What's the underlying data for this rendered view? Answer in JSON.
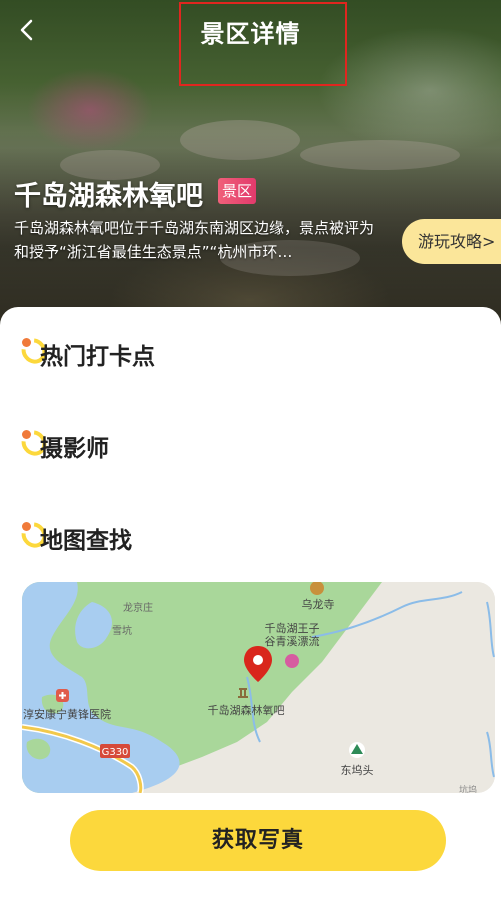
{
  "header": {
    "title": "景区详情"
  },
  "scenic": {
    "name": "千岛湖森林氧吧",
    "badge": "景区",
    "description": "千岛湖森林氧吧位于千岛湖东南湖区边缘，景点被评为和授予“浙江省最佳生态景点”“杭州市环…",
    "guide_button": "游玩攻略>"
  },
  "sections": {
    "hot_spots": "热门打卡点",
    "photographer": "摄影师",
    "map_search": "地图查找"
  },
  "map": {
    "labels": {
      "wulong_temple": "乌龙寺",
      "longjing": "龙京庄",
      "xuekeng": "雪坑",
      "rafting_1": "千岛湖王子",
      "rafting_2": "谷青溪漂流",
      "hospital": "淳安康宁黄锋医院",
      "road": "G330",
      "scenic_spot": "千岛湖森林氧吧",
      "dongwutou": "东坞头",
      "edge": "坑坞"
    },
    "colors": {
      "water": "#a8cdf0",
      "green": "#a9d79a",
      "land": "#ebe8e1",
      "pin": "#d9261c"
    }
  },
  "actions": {
    "get_photo": "获取写真"
  }
}
